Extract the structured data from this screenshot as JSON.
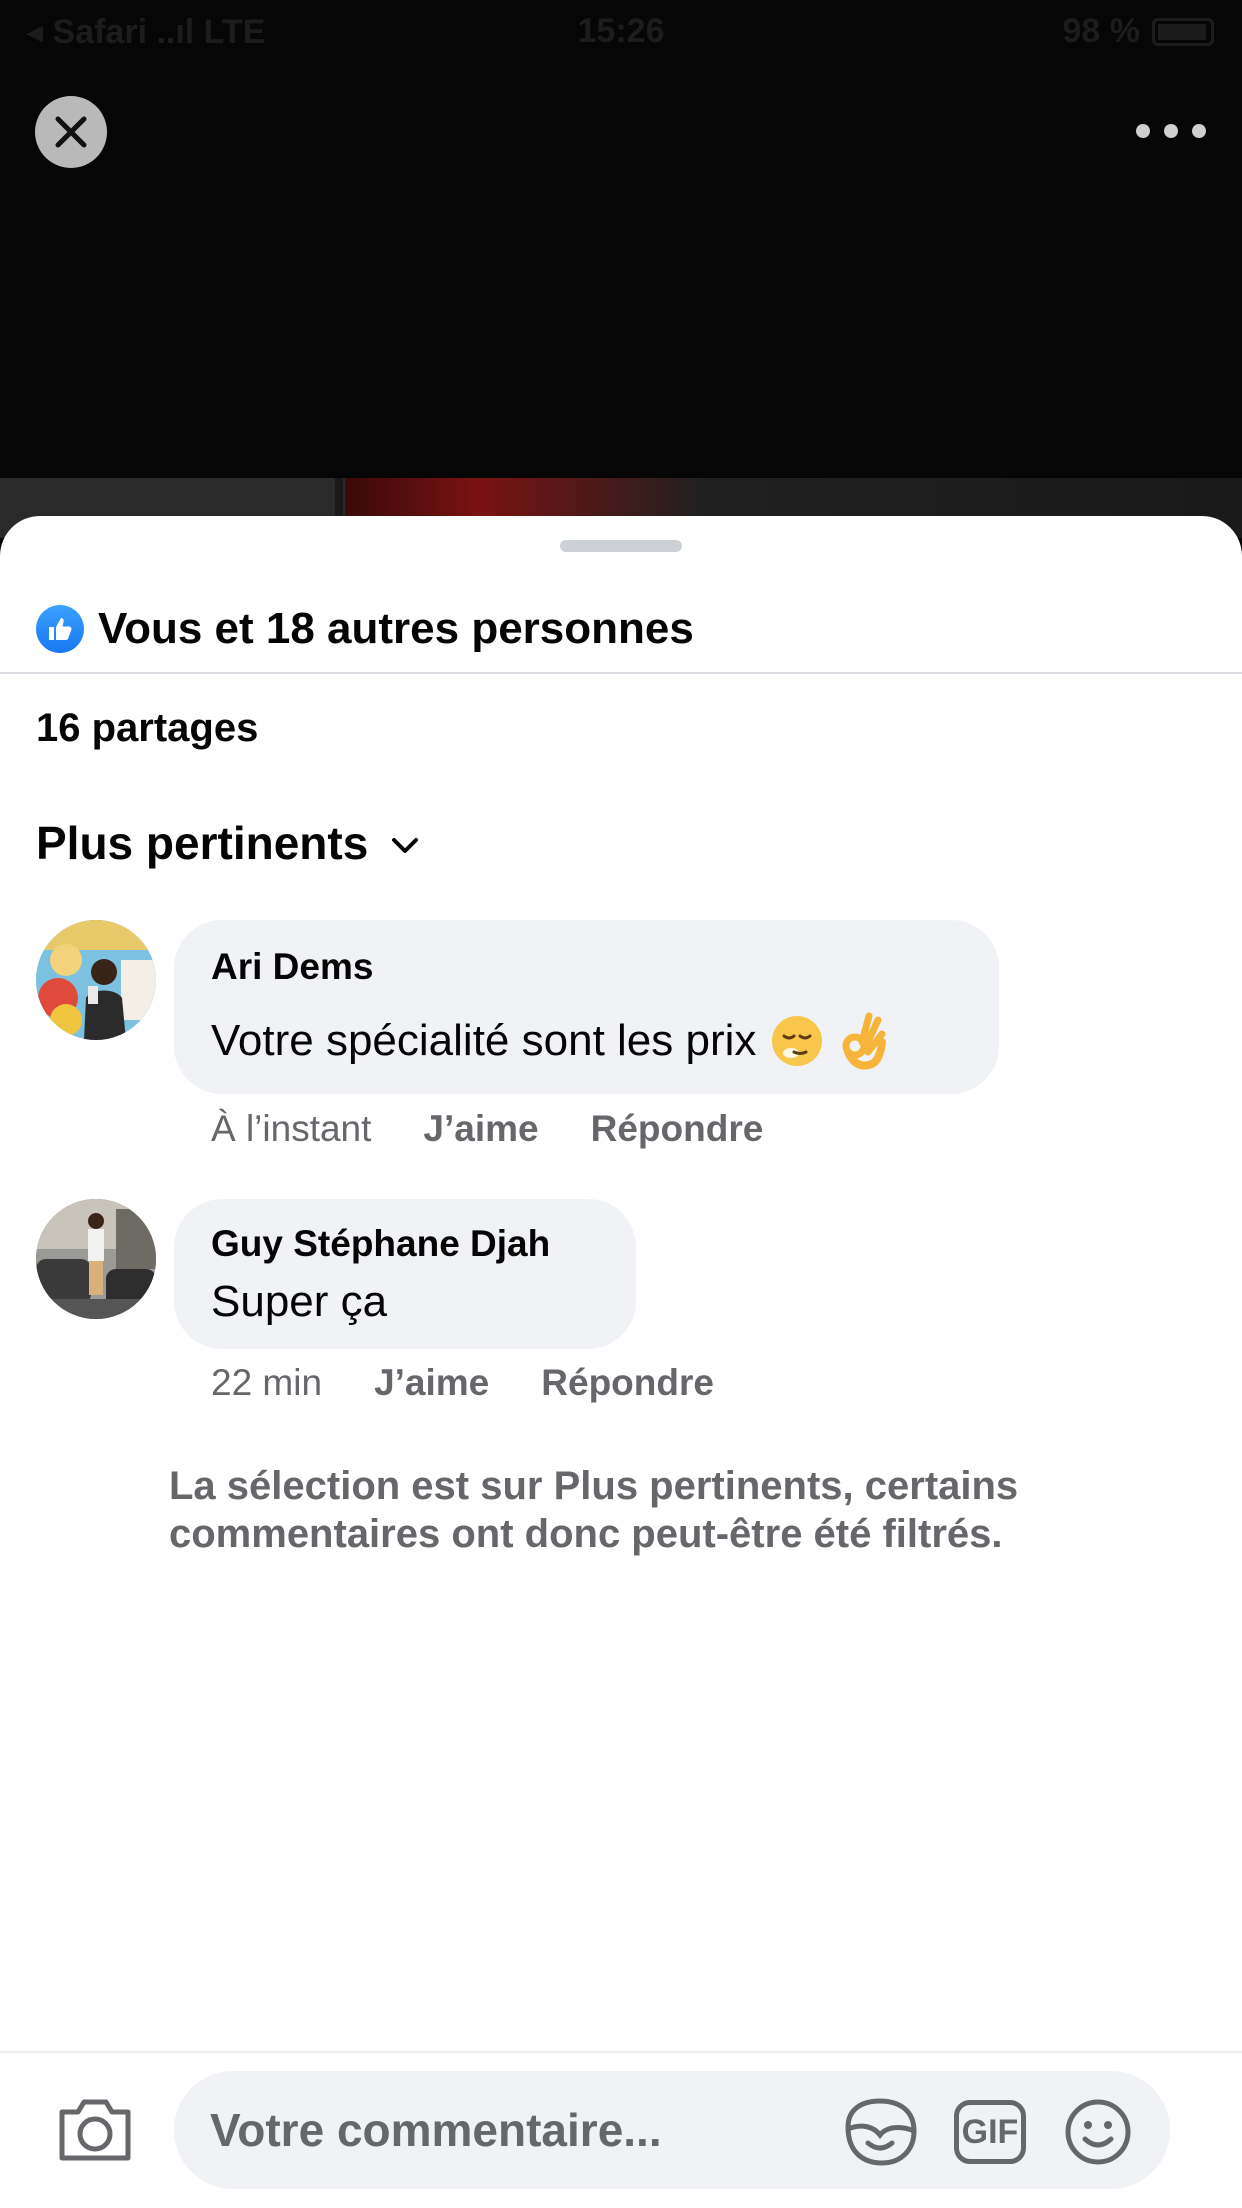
{
  "status_bar": {
    "left": "◂ Safari ..ıl LTE",
    "time": "15:26",
    "battery": "98 %"
  },
  "header": {
    "close_icon": "close-icon",
    "more_icon": "more-horizontal-icon"
  },
  "reactions": {
    "icon": "like-thumb-icon",
    "text": "Vous et 18 autres personnes"
  },
  "shares": "16 partages",
  "sort": {
    "label": "Plus pertinents",
    "icon": "chevron-down-icon"
  },
  "comments": [
    {
      "author": "Ari Dems",
      "text": "Votre spécialité sont les prix",
      "time": "À l’instant",
      "like_label": "J’aime",
      "reply_label": "Répondre"
    },
    {
      "author": "Guy Stéphane Djah",
      "text": "Super ça",
      "time": "22 min",
      "like_label": "J’aime",
      "reply_label": "Répondre"
    }
  ],
  "filter_note": "La sélection est sur Plus pertinents, certains commentaires ont donc peut-être été filtrés.",
  "composer": {
    "placeholder": "Votre commentaire...",
    "gif_label": "GIF"
  },
  "colors": {
    "accent": "#1877f2",
    "bubble": "#f0f2f5",
    "secondary_text": "#65676b"
  }
}
